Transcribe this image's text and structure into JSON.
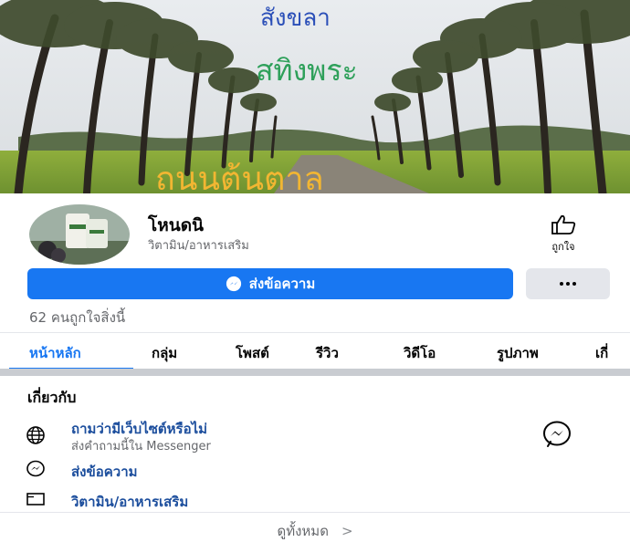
{
  "cover": {
    "handwriting": [
      "สังขลา",
      "สทิงพระ",
      "ถนนต้นตาล"
    ]
  },
  "profile": {
    "name": "โหนดนิ",
    "category": "วิตามิน/อาหารเสริม",
    "like_label": "ถูกใจ"
  },
  "actions": {
    "message_label": "ส่งข้อความ",
    "more_icon": "more-dots-icon"
  },
  "likes_text": "62 คนถูกใจสิ่งนี้",
  "tabs": [
    {
      "label": "หน้าหลัก",
      "active": true
    },
    {
      "label": "กลุ่ม"
    },
    {
      "label": "โพสต์"
    },
    {
      "label": "รีวิว"
    },
    {
      "label": "วิดีโอ"
    },
    {
      "label": "รูปภาพ"
    },
    {
      "label": "เกี่"
    }
  ],
  "about": {
    "title": "เกี่ยวกับ",
    "rows": [
      {
        "icon": "globe-icon",
        "title": "ถามว่ามีเว็บไซต์หรือไม่",
        "subtitle": "ส่งคำถามนี้ใน Messenger"
      },
      {
        "icon": "messenger-icon",
        "title": "ส่งข้อความ"
      },
      {
        "icon": "category-card-icon",
        "title": "วิตามิน/อาหารเสริม"
      }
    ],
    "see_all": "ดูทั้งหมด",
    "see_all_chevron": ">"
  },
  "colors": {
    "brand_blue": "#1877f2",
    "link_blue": "#1c4e9d",
    "secondary_text": "#65676b"
  }
}
